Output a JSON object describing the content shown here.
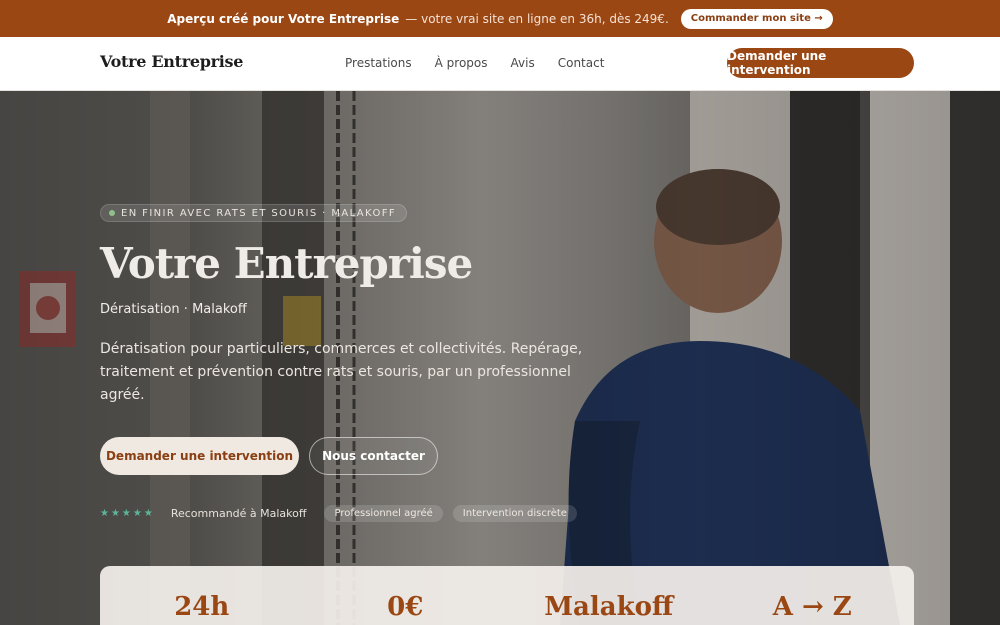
{
  "banner": {
    "lead": "Aperçu créé pour Votre Entreprise",
    "rest": "— votre vrai site en ligne en 36h, dès 249€.",
    "cta": "Commander mon site →"
  },
  "nav": {
    "brand": "Votre Entreprise",
    "links": [
      "Prestations",
      "À propos",
      "Avis",
      "Contact"
    ],
    "cta": "Demander une intervention"
  },
  "hero": {
    "eyebrow": "EN FINIR AVEC RATS ET SOURIS · MALAKOFF",
    "title": "Votre Entreprise",
    "subtitle": "Dératisation · Malakoff",
    "description": "Dératisation pour particuliers, commerces et collectivités. Repérage, traitement et prévention contre rats et souris, par un professionnel agréé.",
    "primary_cta": "Demander une intervention",
    "secondary_cta": "Nous contacter",
    "stars": "★★★★★",
    "recommendation": "Recommandé à Malakoff",
    "chips": [
      "Professionnel agréé",
      "Intervention discrète"
    ]
  },
  "stats": [
    "24h",
    "0€",
    "Malakoff",
    "A → Z"
  ],
  "colors": {
    "accent": "#9a4713",
    "star": "#5bb59a"
  }
}
